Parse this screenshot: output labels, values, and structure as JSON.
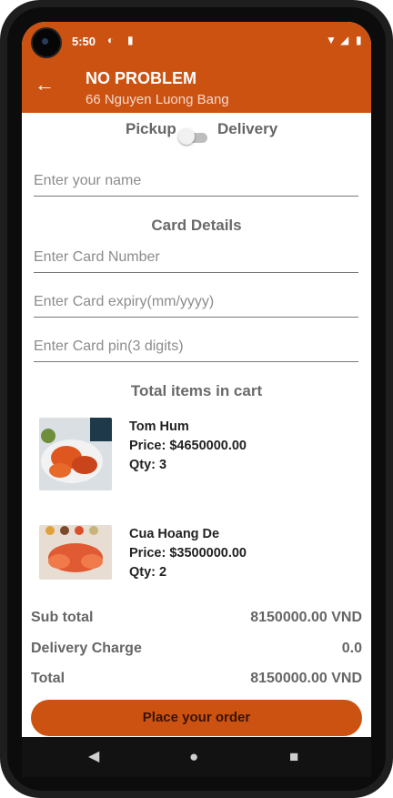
{
  "status": {
    "time": "5:50"
  },
  "appbar": {
    "title": "NO PROBLEM",
    "subtitle": "66 Nguyen Luong Bang"
  },
  "mode": {
    "pickup_label": "Pickup",
    "delivery_label": "Delivery",
    "delivery_selected": false
  },
  "form": {
    "name_placeholder": "Enter your name",
    "card_section": "Card Details",
    "card_number_placeholder": "Enter Card Number",
    "card_expiry_placeholder": "Enter Card expiry(mm/yyyy)",
    "card_pin_placeholder": "Enter Card pin(3 digits)"
  },
  "cart": {
    "heading": "Total items in cart",
    "items": [
      {
        "name": "Tom Hum",
        "price": "Price: $4650000.00",
        "qty": "Qty: 3"
      },
      {
        "name": "Cua Hoang De",
        "price": "Price: $3500000.00",
        "qty": "Qty: 2"
      }
    ]
  },
  "summary": {
    "subtotal_label": "Sub total",
    "subtotal_value": "8150000.00 VND",
    "delivery_label": "Delivery Charge",
    "delivery_value": "0.0",
    "total_label": "Total",
    "total_value": "8150000.00 VND"
  },
  "actions": {
    "place_order": "Place your order"
  },
  "colors": {
    "primary": "#cc5211",
    "text_muted": "#666666"
  }
}
